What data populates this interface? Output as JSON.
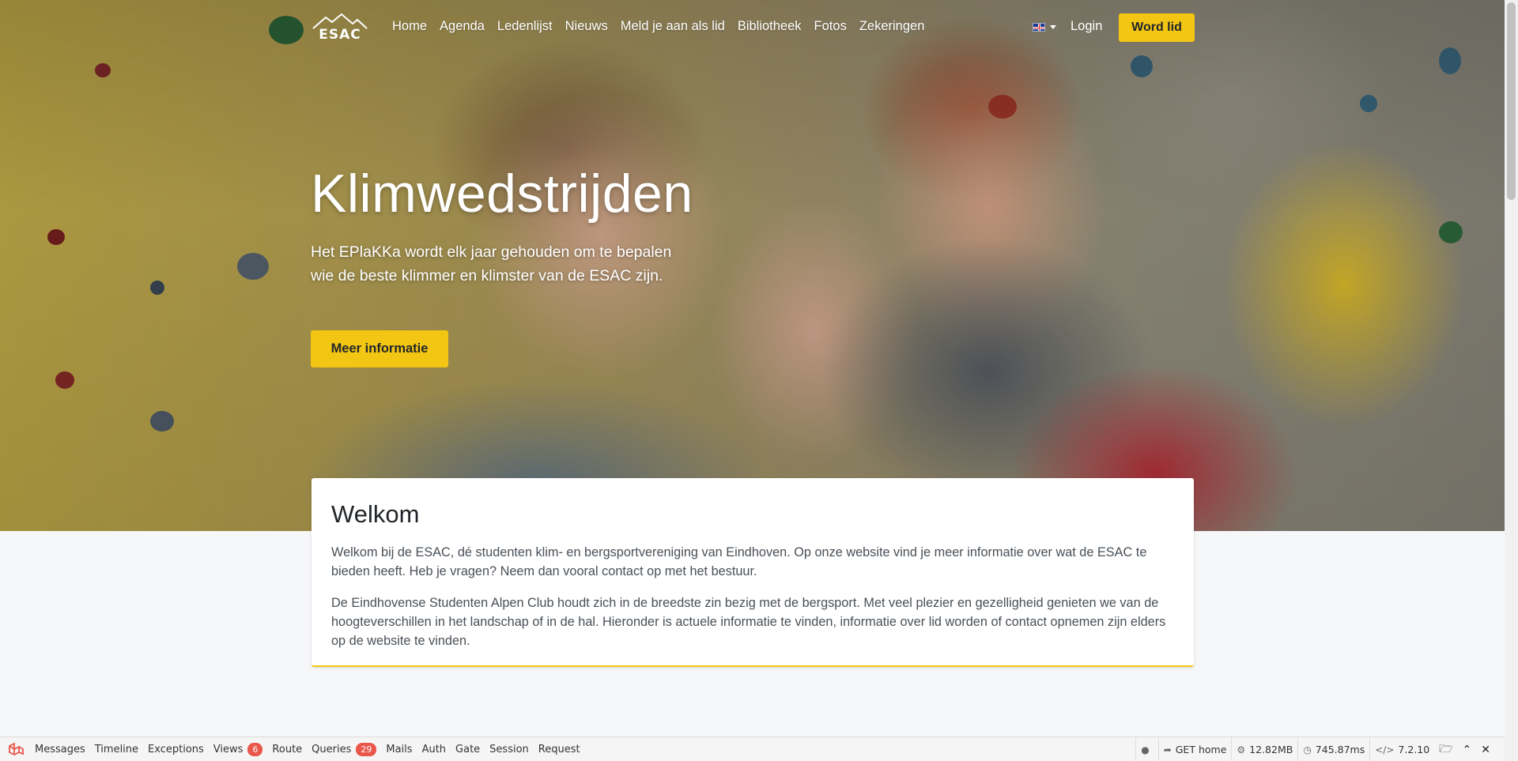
{
  "brand": {
    "logo_text": "ESAC"
  },
  "nav": {
    "items": [
      {
        "label": "Home"
      },
      {
        "label": "Agenda"
      },
      {
        "label": "Ledenlijst"
      },
      {
        "label": "Nieuws"
      },
      {
        "label": "Meld je aan als lid"
      },
      {
        "label": "Bibliotheek"
      },
      {
        "label": "Fotos"
      },
      {
        "label": "Zekeringen"
      }
    ],
    "login_label": "Login",
    "join_label": "Word lid"
  },
  "hero": {
    "title": "Klimwedstrijden",
    "text": "Het EPlaKKa wordt elk jaar gehouden om te bepalen wie de beste klimmer en klimster van de ESAC zijn.",
    "button_label": "Meer informatie"
  },
  "welcome": {
    "title": "Welkom",
    "paragraph1": "Welkom bij de ESAC, dé studenten klim- en bergsportvereniging van Eindhoven. Op onze website vind je meer informatie over wat de ESAC te bieden heeft. Heb je vragen? Neem dan vooral contact op met het bestuur.",
    "paragraph2": "De Eindhovense Studenten Alpen Club houdt zich in de breedste zin bezig met de bergsport. Met veel plezier en gezelligheid genieten we van de hoogteverschillen in het landschap of in de hal. Hieronder is actuele informatie te vinden, informatie over lid worden of contact opnemen zijn elders op de website te vinden."
  },
  "debugbar": {
    "tabs": {
      "messages": "Messages",
      "timeline": "Timeline",
      "exceptions": "Exceptions",
      "views": "Views",
      "views_count": "6",
      "route": "Route",
      "queries": "Queries",
      "queries_count": "29",
      "mails": "Mails",
      "auth": "Auth",
      "gate": "Gate",
      "session": "Session",
      "request": "Request"
    },
    "route": "GET home",
    "memory": "12.82MB",
    "time": "745.87ms",
    "php_version": "7.2.10"
  },
  "colors": {
    "accent": "#f3c613",
    "badge": "#e8574a"
  }
}
